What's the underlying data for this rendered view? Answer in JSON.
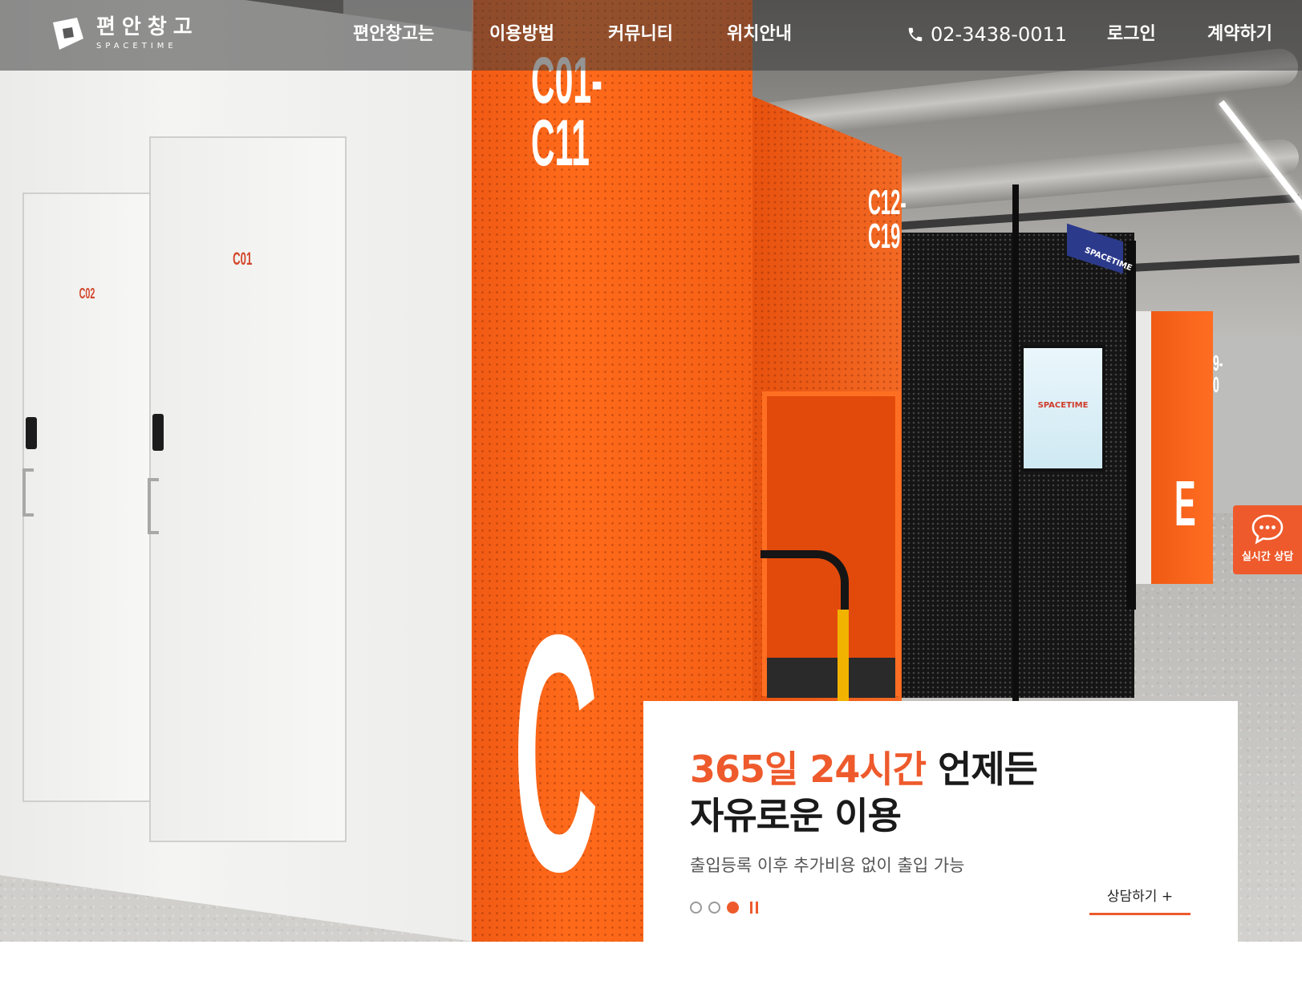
{
  "brand": {
    "name_ko": "편안창고",
    "name_en": "SPACETIME"
  },
  "nav": {
    "items": [
      {
        "label": "편안창고는"
      },
      {
        "label": "이용방법"
      },
      {
        "label": "커뮤니티"
      },
      {
        "label": "위치안내"
      }
    ],
    "phone": "02-3438-0011",
    "login_label": "로그인",
    "contract_label": "계약하기"
  },
  "hero": {
    "locker_labels": [
      "C01",
      "C02"
    ],
    "unit_label_front": "C01-\nC11",
    "unit_label_side": "C12-\nC19",
    "big_letter": "C",
    "screen_logo": "SPACETIME",
    "sign_text": "SPACETIME",
    "far_label": "9-\n0",
    "far_letter": "E"
  },
  "slide": {
    "title_accent": "365일 24시간",
    "title_rest": " 언제든",
    "title_line2": "자유로운 이용",
    "subtitle": "출입등록 이후 추가비용 없이 출입 가능",
    "cta_label": "상담하기 +",
    "total_slides": 3,
    "active_slide": 3
  },
  "chat_widget": {
    "label": "실시간 상담",
    "icon": "chat-bubble-icon"
  },
  "colors": {
    "accent": "#ee5a2c",
    "header_overlay": "rgba(60,60,60,0.55)",
    "text_dark": "#1a1a1a"
  }
}
